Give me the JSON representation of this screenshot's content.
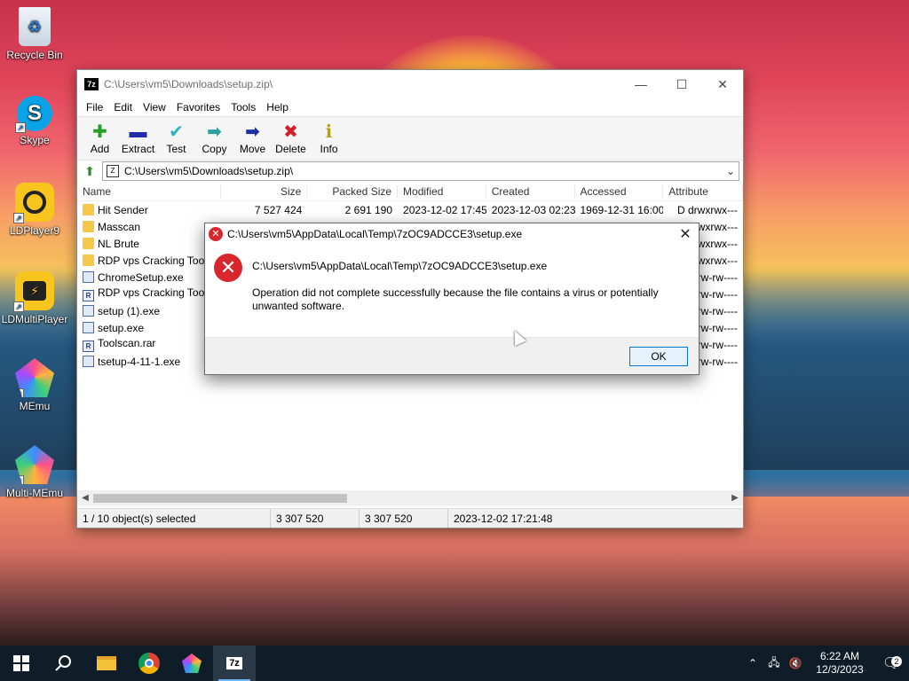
{
  "desktop": {
    "icons": [
      {
        "label": "Recycle Bin",
        "icon": "recycle-bin-icon"
      },
      {
        "label": "Skype",
        "icon": "skype-icon"
      },
      {
        "label": "LDPlayer9",
        "icon": "ldplayer-icon"
      },
      {
        "label": "LDMultiPlayer",
        "icon": "ldmultiplayer-icon"
      },
      {
        "label": "MEmu",
        "icon": "memu-icon"
      },
      {
        "label": "Multi-MEmu",
        "icon": "multi-memu-icon"
      }
    ]
  },
  "window": {
    "badge": "7z",
    "title": "C:\\Users\\vm5\\Downloads\\setup.zip\\",
    "controls": {
      "minimize": "—",
      "maximize": "☐",
      "close": "✕"
    },
    "menu": [
      "File",
      "Edit",
      "View",
      "Favorites",
      "Tools",
      "Help"
    ],
    "toolbar": [
      {
        "label": "Add",
        "glyph": "✚",
        "color": "#22a022",
        "icon": "add-icon"
      },
      {
        "label": "Extract",
        "glyph": "▬",
        "color": "#1c2fa8",
        "icon": "extract-icon"
      },
      {
        "label": "Test",
        "glyph": "✔",
        "color": "#27b5c9",
        "icon": "test-icon"
      },
      {
        "label": "Copy",
        "glyph": "➡",
        "color": "#2aa19b",
        "icon": "copy-icon"
      },
      {
        "label": "Move",
        "glyph": "➡",
        "color": "#1c2fa8",
        "icon": "move-icon"
      },
      {
        "label": "Delete",
        "glyph": "✖",
        "color": "#d0202a",
        "icon": "delete-icon"
      },
      {
        "label": "Info",
        "glyph": "ℹ",
        "color": "#b8a400",
        "icon": "info-icon"
      }
    ],
    "address": "C:\\Users\\vm5\\Downloads\\setup.zip\\",
    "columns": [
      "Name",
      "Size",
      "Packed Size",
      "Modified",
      "Created",
      "Accessed",
      "Attribute"
    ],
    "files": [
      {
        "type": "folder",
        "name": "Hit Sender",
        "size": "7 527 424",
        "packed": "2 691 190",
        "modified": "2023-12-02 17:45",
        "created": "2023-12-03 02:23",
        "accessed": "1969-12-31 16:00",
        "attr": "D drwxrwx---"
      },
      {
        "type": "folder",
        "name": "Masscan",
        "size": "",
        "packed": "",
        "modified": "",
        "created": "",
        "accessed": "",
        "attr": "rwxrwx---"
      },
      {
        "type": "folder",
        "name": "NL Brute",
        "size": "",
        "packed": "",
        "modified": "",
        "created": "",
        "accessed": "",
        "attr": "rwxrwx---"
      },
      {
        "type": "folder",
        "name": "RDP vps Cracking Tools",
        "size": "",
        "packed": "",
        "modified": "",
        "created": "",
        "accessed": "",
        "attr": "rwxrwx---"
      },
      {
        "type": "exe",
        "name": "ChromeSetup.exe",
        "size": "",
        "packed": "",
        "modified": "",
        "created": "",
        "accessed": "",
        "attr": "-rw-rw----"
      },
      {
        "type": "rar",
        "name": "RDP vps Cracking Tools",
        "size": "",
        "packed": "",
        "modified": "",
        "created": "",
        "accessed": "",
        "attr": "-rw-rw----"
      },
      {
        "type": "exe",
        "name": "setup (1).exe",
        "size": "",
        "packed": "",
        "modified": "",
        "created": "",
        "accessed": "",
        "attr": "-rw-rw----"
      },
      {
        "type": "exe",
        "name": "setup.exe",
        "size": "",
        "packed": "",
        "modified": "",
        "created": "",
        "accessed": "",
        "attr": "-rw-rw----"
      },
      {
        "type": "rar",
        "name": "Toolscan.rar",
        "size": "",
        "packed": "",
        "modified": "",
        "created": "",
        "accessed": "",
        "attr": "-rw-rw----"
      },
      {
        "type": "exe",
        "name": "tsetup-4-11-1.exe",
        "size": "",
        "packed": "",
        "modified": "",
        "created": "",
        "accessed": "",
        "attr": "-rw-rw----"
      }
    ],
    "status": {
      "selection": "1 / 10 object(s) selected",
      "size": "3 307 520",
      "packed": "3 307 520",
      "date": "2023-12-02 17:21:48"
    }
  },
  "dialog": {
    "title": "C:\\Users\\vm5\\AppData\\Local\\Temp\\7zOC9ADCCE3\\setup.exe",
    "path": "C:\\Users\\vm5\\AppData\\Local\\Temp\\7zOC9ADCCE3\\setup.exe",
    "message": "Operation did not complete successfully because the file contains a virus or potentially unwanted software.",
    "ok_label": "OK",
    "close": "✕"
  },
  "taskbar": {
    "apps": [
      "start-icon",
      "search-icon",
      "file-explorer-icon",
      "chrome-icon",
      "memu-icon",
      "7zip-icon"
    ],
    "active_app": "7z",
    "time": "6:22 AM",
    "date": "12/3/2023",
    "notifications": "2"
  }
}
